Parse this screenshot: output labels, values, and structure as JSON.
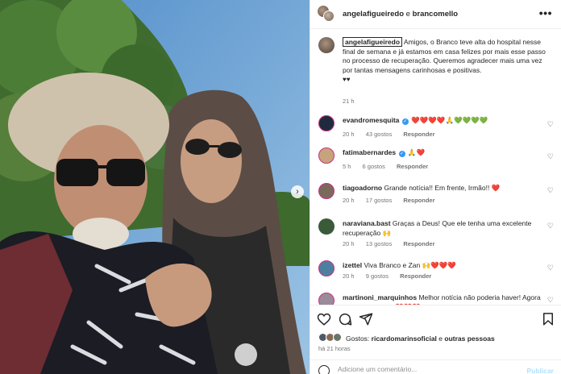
{
  "post": {
    "photo_alt": "",
    "carousel_next_glyph": "›"
  },
  "header": {
    "user_1": "angelafigueiredo",
    "joiner": " e ",
    "user_2": "brancomello",
    "more_glyph": "•••"
  },
  "caption": {
    "username": "angelafigueiredo",
    "text": "Amigos, o Branco teve alta do hospital nesse final de semana e já estamos em casa felizes por mais esse passo no processo de recuperação. Queremos agradecer mais uma vez por tantas mensagens carinhosas e positivas.",
    "hearts": "♥♥",
    "time": "21 h"
  },
  "comments": [
    {
      "username": "evandromesquita",
      "verified": true,
      "text": "❤️❤️❤️❤️🙏💚💚💚💚",
      "time": "20 h",
      "likes": "43 gostos",
      "reply": "Responder",
      "avatar_color": "#1f2b3d"
    },
    {
      "username": "fatimabernardes",
      "verified": true,
      "text": "🙏❤️",
      "time": "5 h",
      "likes": "6 gostos",
      "reply": "Responder",
      "avatar_color": "#c8a27c"
    },
    {
      "username": "tiagoadorno",
      "verified": false,
      "text": "Grande notícia!! Em frente, Irmão!! ❤️",
      "time": "20 h",
      "likes": "17 gostos",
      "reply": "Responder",
      "avatar_color": "#7b6a5c"
    },
    {
      "username": "naraviana.bast",
      "verified": false,
      "text": "Graças a Deus! Que ele tenha uma excelente recuperação 🙌",
      "time": "20 h",
      "likes": "13 gostos",
      "reply": "Responder",
      "avatar_color": "#3a5a3a"
    },
    {
      "username": "izettel",
      "verified": false,
      "text": "Viva Branco e Zan 🙌❤️❤️❤️",
      "time": "20 h",
      "likes": "9 gostos",
      "reply": "Responder",
      "avatar_color": "#4f7f9f"
    },
    {
      "username": "martinoni_marquinhos",
      "verified": false,
      "text": "Melhor notícia não poderia haver! Agora é cuidar e cuidar ❤️❤️❤️",
      "time": "",
      "likes": "",
      "reply": "",
      "avatar_color": "#9a8a9a"
    }
  ],
  "likes": {
    "prefix": "Gostos: ",
    "user": "ricardomarinsoficial",
    "joiner": " e ",
    "others": "outras pessoas"
  },
  "post_time": "há 21 horas",
  "add_comment": {
    "placeholder": "Adicione um comentário...",
    "publish": "Publicar"
  },
  "colors": {
    "verified": "#3897f0",
    "text": "#262626",
    "muted": "#737373",
    "publish_disabled": "#b2dffc"
  },
  "icons": {
    "like": "heart-icon",
    "comment": "comment-icon",
    "share": "share-icon",
    "save": "bookmark-icon",
    "emoji": "emoji-icon"
  }
}
